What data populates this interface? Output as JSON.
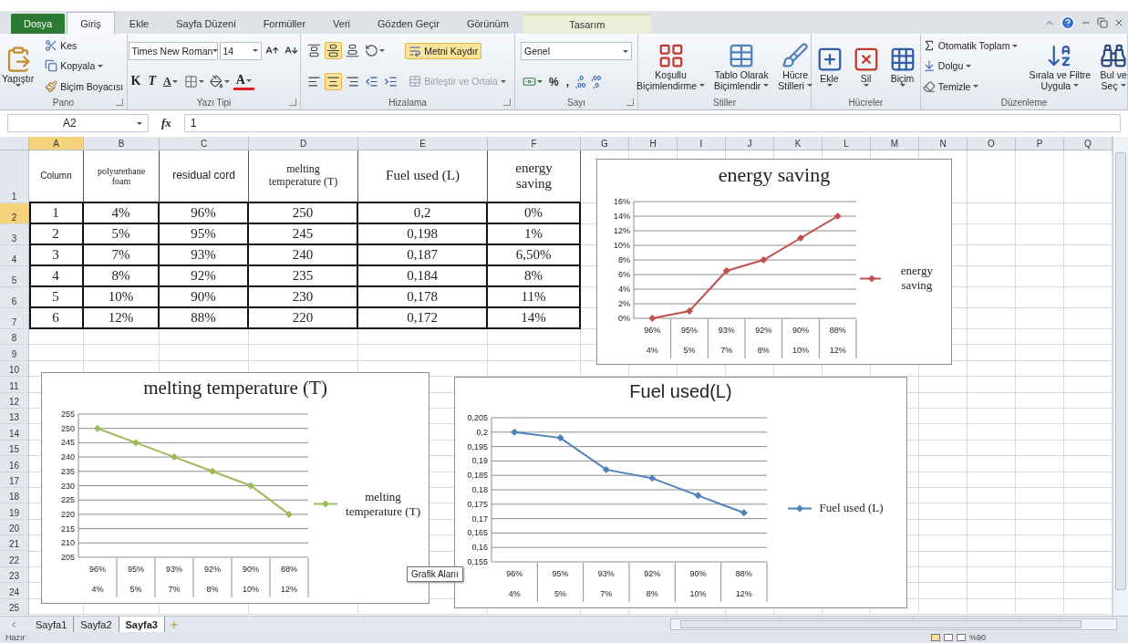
{
  "ribbon": {
    "tabs": [
      {
        "label": "Dosya",
        "kind": "file",
        "selected": false
      },
      {
        "label": "Giriş",
        "kind": "tab",
        "selected": true
      },
      {
        "label": "Ekle",
        "kind": "tab",
        "selected": false
      },
      {
        "label": "Sayfa Düzeni",
        "kind": "tab",
        "selected": false
      },
      {
        "label": "Formüller",
        "kind": "tab",
        "selected": false
      },
      {
        "label": "Veri",
        "kind": "tab",
        "selected": false
      },
      {
        "label": "Gözden Geçir",
        "kind": "tab",
        "selected": false
      },
      {
        "label": "Görünüm",
        "kind": "tab",
        "selected": false
      },
      {
        "label": "Tasarım",
        "kind": "contextual",
        "selected": false
      }
    ],
    "groups": [
      {
        "label": "Pano",
        "launcher": true,
        "columns": [
          [
            [
              {
                "kind": "large",
                "lines": [
                  "Yapıştır"
                ],
                "dropdown": true
              }
            ]
          ],
          [
            [
              {
                "kind": "small",
                "label": "Kes",
                "dropdown": false
              }
            ],
            [
              {
                "kind": "small",
                "label": "Kopyala",
                "dropdown": true
              }
            ],
            [
              {
                "kind": "small",
                "label": "Biçim Boyacısı",
                "dropdown": false
              }
            ]
          ]
        ]
      },
      {
        "label": "Yazı Tipi",
        "launcher": true,
        "columns": [
          [
            [
              {
                "kind": "combo",
                "value": "Times New Roman"
              },
              {
                "kind": "combo",
                "value": "14"
              },
              {
                "kind": "icon",
                "selected": false,
                "dropdown": false
              },
              {
                "kind": "icon",
                "selected": false,
                "dropdown": false
              }
            ],
            [
              {
                "kind": "glyph",
                "label": "K",
                "dropdown": false
              },
              {
                "kind": "glyph",
                "label": "T",
                "dropdown": false
              },
              {
                "kind": "glyph",
                "label": "A",
                "dropdown": true
              },
              {
                "kind": "icon",
                "selected": false,
                "dropdown": true
              },
              {
                "kind": "icon",
                "selected": false,
                "dropdown": true
              },
              {
                "kind": "glyph",
                "label": "A",
                "dropdown": true
              }
            ]
          ]
        ]
      },
      {
        "label": "Hizalama",
        "launcher": true,
        "columns": [
          [
            [
              {
                "kind": "icon",
                "selected": false,
                "dropdown": false
              },
              {
                "kind": "icon",
                "selected": true,
                "dropdown": false
              },
              {
                "kind": "icon",
                "selected": false,
                "dropdown": false
              },
              {
                "kind": "icon",
                "selected": false,
                "dropdown": true
              }
            ],
            [
              {
                "kind": "icon",
                "selected": false,
                "dropdown": false
              },
              {
                "kind": "icon",
                "selected": true,
                "dropdown": false
              },
              {
                "kind": "icon",
                "selected": false,
                "dropdown": false
              },
              {
                "kind": "icon",
                "selected": false,
                "dropdown": false
              },
              {
                "kind": "icon",
                "selected": false,
                "dropdown": false
              }
            ]
          ],
          [
            [
              {
                "kind": "toggle",
                "label": "Metni Kaydır",
                "selected": true
              }
            ],
            [
              {
                "kind": "small",
                "label": "Birleştir ve Ortala",
                "dropdown": true,
                "disabled": true
              }
            ]
          ]
        ]
      },
      {
        "label": "Sayı",
        "launcher": true,
        "columns": [
          [
            [
              {
                "kind": "combo",
                "value": "Genel"
              }
            ],
            [
              {
                "kind": "icon",
                "selected": false,
                "dropdown": true
              },
              {
                "kind": "glyph",
                "label": "%",
                "dropdown": false
              },
              {
                "kind": "glyph",
                "label": ",",
                "dropdown": false
              },
              {
                "kind": "decimal",
                "lines": [
                  ",0",
                  ",00"
                ]
              },
              {
                "kind": "decimal",
                "lines": [
                  ",00",
                  ",0"
                ]
              }
            ]
          ]
        ]
      },
      {
        "label": "Stiller",
        "launcher": false,
        "columns": [
          [
            [
              {
                "kind": "large",
                "lines": [
                  "Koşullu",
                  "Biçimlendirme"
                ],
                "dropdown": true
              }
            ]
          ],
          [
            [
              {
                "kind": "large",
                "lines": [
                  "Tablo Olarak",
                  "Biçimlendir"
                ],
                "dropdown": true
              }
            ]
          ],
          [
            [
              {
                "kind": "large",
                "lines": [
                  "Hücre",
                  "Stilleri"
                ],
                "dropdown": true
              }
            ]
          ]
        ]
      },
      {
        "label": "Hücreler",
        "launcher": false,
        "columns": [
          [
            [
              {
                "kind": "large",
                "lines": [
                  "Ekle"
                ],
                "dropdown": true
              }
            ]
          ],
          [
            [
              {
                "kind": "large",
                "lines": [
                  "Sil"
                ],
                "dropdown": true
              }
            ]
          ],
          [
            [
              {
                "kind": "large",
                "lines": [
                  "Biçim"
                ],
                "dropdown": true
              }
            ]
          ]
        ]
      },
      {
        "label": "Düzenleme",
        "launcher": false,
        "columns": [
          [
            [
              {
                "kind": "small",
                "label": "Otomatik Toplam",
                "dropdown": true
              }
            ],
            [
              {
                "kind": "small",
                "label": "Dolgu",
                "dropdown": true
              }
            ],
            [
              {
                "kind": "small",
                "label": "Temizle",
                "dropdown": true
              }
            ]
          ],
          [
            [
              {
                "kind": "large",
                "lines": [
                  "Sırala ve Filtre",
                  "Uygula"
                ],
                "dropdown": true
              }
            ]
          ],
          [
            [
              {
                "kind": "large",
                "lines": [
                  "Bul ve",
                  "Seç"
                ],
                "dropdown": true
              }
            ]
          ]
        ]
      }
    ]
  },
  "formula_bar": {
    "name_box": "A2",
    "function_label": "fx",
    "value": "1"
  },
  "sheet": {
    "columns": [
      {
        "label": "A",
        "selected": true
      },
      {
        "label": "B",
        "selected": false
      },
      {
        "label": "C",
        "selected": false
      },
      {
        "label": "D",
        "selected": false
      },
      {
        "label": "E",
        "selected": false
      },
      {
        "label": "F",
        "selected": false
      },
      {
        "label": "G",
        "selected": false
      },
      {
        "label": "H",
        "selected": false
      },
      {
        "label": "I",
        "selected": false
      },
      {
        "label": "J",
        "selected": false
      },
      {
        "label": "K",
        "selected": false
      },
      {
        "label": "L",
        "selected": false
      },
      {
        "label": "M",
        "selected": false
      },
      {
        "label": "N",
        "selected": false
      },
      {
        "label": "O",
        "selected": false
      },
      {
        "label": "P",
        "selected": false
      },
      {
        "label": "Q",
        "selected": false
      }
    ],
    "rows": [
      {
        "number": "1",
        "selected": false,
        "cells": [
          "Column",
          "polyurethane foam",
          "residual cord",
          "melting temperature (T)",
          "Fuel used (L)",
          "energy saving"
        ]
      },
      {
        "number": "2",
        "selected": true,
        "cells": [
          "1",
          "4%",
          "96%",
          "250",
          "0,2",
          "0%"
        ]
      },
      {
        "number": "3",
        "selected": false,
        "cells": [
          "2",
          "5%",
          "95%",
          "245",
          "0,198",
          "1%"
        ]
      },
      {
        "number": "4",
        "selected": false,
        "cells": [
          "3",
          "7%",
          "93%",
          "240",
          "0,187",
          "6,50%"
        ]
      },
      {
        "number": "5",
        "selected": false,
        "cells": [
          "4",
          "8%",
          "92%",
          "235",
          "0,184",
          "8%"
        ]
      },
      {
        "number": "6",
        "selected": false,
        "cells": [
          "5",
          "10%",
          "90%",
          "230",
          "0,178",
          "11%"
        ]
      },
      {
        "number": "7",
        "selected": false,
        "cells": [
          "6",
          "12%",
          "88%",
          "220",
          "0,172",
          "14%"
        ]
      },
      {
        "number": "8",
        "selected": false
      },
      {
        "number": "9",
        "selected": false
      },
      {
        "number": "10",
        "selected": false
      },
      {
        "number": "11",
        "selected": false
      },
      {
        "number": "12",
        "selected": false
      },
      {
        "number": "13",
        "selected": false
      },
      {
        "number": "14",
        "selected": false
      },
      {
        "number": "15",
        "selected": false
      },
      {
        "number": "16",
        "selected": false
      },
      {
        "number": "17",
        "selected": false
      },
      {
        "number": "18",
        "selected": false
      },
      {
        "number": "19",
        "selected": false
      },
      {
        "number": "20",
        "selected": false
      },
      {
        "number": "21",
        "selected": false
      },
      {
        "number": "22",
        "selected": false
      },
      {
        "number": "23",
        "selected": false
      },
      {
        "number": "24",
        "selected": false
      },
      {
        "number": "25",
        "selected": false
      }
    ]
  },
  "charts": [
    {
      "chart_data": {
        "type": "line",
        "title": "energy saving",
        "grid": true,
        "categories": [
          [
            "96%",
            "4%"
          ],
          [
            "95%",
            "5%"
          ],
          [
            "93%",
            "7%"
          ],
          [
            "92%",
            "8%"
          ],
          [
            "90%",
            "10%"
          ],
          [
            "88%",
            "12%"
          ]
        ],
        "series": [
          {
            "name": "energy saving",
            "color": "#c0504d",
            "marker": "diamond",
            "values": [
              0,
              0.01,
              0.065,
              0.08,
              0.11,
              0.14
            ]
          }
        ],
        "ylim": [
          0,
          0.16
        ],
        "yticks": [
          {
            "value": 0,
            "label": "0%"
          },
          {
            "value": 0.02,
            "label": "2%"
          },
          {
            "value": 0.04,
            "label": "4%"
          },
          {
            "value": 0.06,
            "label": "6%"
          },
          {
            "value": 0.08,
            "label": "8%"
          },
          {
            "value": 0.1,
            "label": "10%"
          },
          {
            "value": 0.12,
            "label": "12%"
          },
          {
            "value": 0.14,
            "label": "14%"
          },
          {
            "value": 0.16,
            "label": "16%"
          }
        ]
      }
    },
    {
      "chart_data": {
        "type": "line",
        "title": "melting temperature (T)",
        "grid": true,
        "categories": [
          [
            "96%",
            "4%"
          ],
          [
            "95%",
            "5%"
          ],
          [
            "93%",
            "7%"
          ],
          [
            "92%",
            "8%"
          ],
          [
            "90%",
            "10%"
          ],
          [
            "88%",
            "12%"
          ]
        ],
        "series": [
          {
            "name": "melting temperature (T)",
            "color": "#9bbb59",
            "marker": "diamond",
            "values": [
              250,
              245,
              240,
              235,
              230,
              220
            ]
          }
        ],
        "ylim": [
          205,
          255
        ],
        "yticks": [
          205,
          210,
          215,
          220,
          225,
          230,
          235,
          240,
          245,
          250,
          255
        ]
      }
    },
    {
      "chart_data": {
        "type": "line",
        "title": "Fuel used(L)",
        "grid": true,
        "categories": [
          [
            "96%",
            "4%"
          ],
          [
            "95%",
            "5%"
          ],
          [
            "93%",
            "7%"
          ],
          [
            "92%",
            "8%"
          ],
          [
            "90%",
            "10%"
          ],
          [
            "88%",
            "12%"
          ]
        ],
        "series": [
          {
            "name": "Fuel used (L)",
            "color": "#4f81bd",
            "marker": "diamond",
            "values": [
              0.2,
              0.198,
              0.187,
              0.184,
              0.178,
              0.172
            ]
          }
        ],
        "ylim": [
          0.155,
          0.205
        ],
        "yticks": [
          {
            "value": 0.155,
            "label": "0,155"
          },
          {
            "value": 0.16,
            "label": "0,16"
          },
          {
            "value": 0.165,
            "label": "0,165"
          },
          {
            "value": 0.17,
            "label": "0,17"
          },
          {
            "value": 0.175,
            "label": "0,175"
          },
          {
            "value": 0.18,
            "label": "0,18"
          },
          {
            "value": 0.185,
            "label": "0,185"
          },
          {
            "value": 0.19,
            "label": "0,19"
          },
          {
            "value": 0.195,
            "label": "0,195"
          },
          {
            "value": 0.2,
            "label": "0,2"
          },
          {
            "value": 0.205,
            "label": "0,205"
          }
        ]
      }
    }
  ],
  "tooltip": "Grafik Alanı",
  "sheet_tabs": [
    {
      "label": "Sayfa1",
      "selected": false
    },
    {
      "label": "Sayfa2",
      "selected": false
    },
    {
      "label": "Sayfa3",
      "selected": true
    }
  ],
  "status_bar": {
    "status": "Hazır",
    "zoom": "%90"
  }
}
